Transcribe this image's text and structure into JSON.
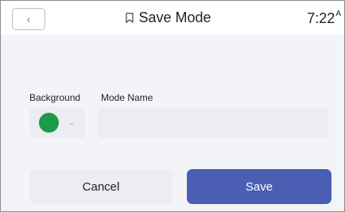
{
  "header": {
    "back_icon": "chevron-left-icon",
    "back_glyph": "‹",
    "title_icon": "bookmark-outline-icon",
    "title": "Save Mode",
    "clock": "7:22",
    "clock_suffix": "A"
  },
  "form": {
    "background_label": "Background",
    "background_color": "#1e9a4a",
    "background_dropdown_icon": "chevron-down-icon",
    "dropdown_glyph": "⌄",
    "mode_name_label": "Mode Name",
    "mode_name_value": "",
    "mode_name_placeholder": ""
  },
  "actions": {
    "cancel_label": "Cancel",
    "save_label": "Save"
  },
  "colors": {
    "accent": "#4b5eb3",
    "panel": "#f3f4f7",
    "field": "#ebedf0"
  }
}
